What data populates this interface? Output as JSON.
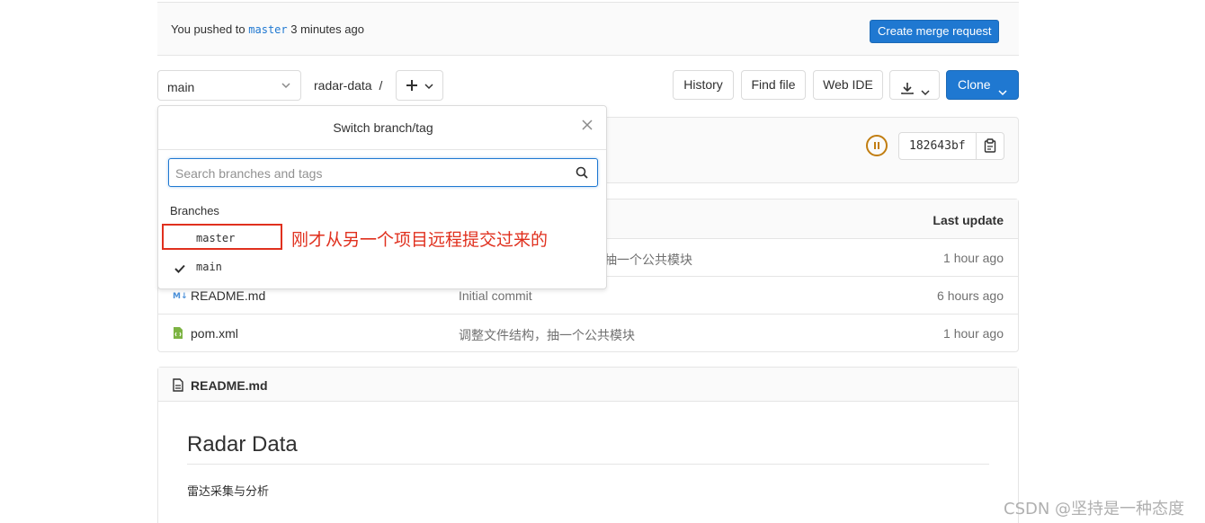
{
  "push_banner": {
    "prefix": "You pushed to",
    "branch": "master",
    "suffix": "3 minutes ago",
    "create_mr_label": "Create merge request"
  },
  "toolbar": {
    "branch_value": "main",
    "breadcrumb_repo": "radar-data",
    "breadcrumb_sep": "/",
    "history_label": "History",
    "find_file_label": "Find file",
    "web_ide_label": "Web IDE",
    "clone_label": "Clone"
  },
  "commit": {
    "sha": "182643bf"
  },
  "file_table": {
    "last_update_header": "Last update",
    "rows": [
      {
        "name": "",
        "message": "抽一个公共模块",
        "updated": "1 hour ago"
      },
      {
        "name": "README.md",
        "message": "Initial commit",
        "updated": "6 hours ago",
        "icon": "markdown-icon"
      },
      {
        "name": "pom.xml",
        "message": "调整文件结构，抽一个公共模块",
        "updated": "1 hour ago",
        "icon": "xml-file-icon"
      }
    ]
  },
  "readme": {
    "file_name": "README.md",
    "heading": "Radar Data",
    "paragraph": "雷达采集与分析"
  },
  "dropdown": {
    "title": "Switch branch/tag",
    "search_placeholder": "Search branches and tags",
    "section_header": "Branches",
    "items": [
      {
        "label": "master",
        "selected": false
      },
      {
        "label": "main",
        "selected": true
      }
    ]
  },
  "annotation": {
    "text": "刚才从另一个项目远程提交过来的"
  },
  "watermark": "CSDN @坚持是一种态度",
  "colors": {
    "primary": "#1f78d1",
    "pipeline": "#c17d10",
    "annotation": "#e0301e"
  }
}
